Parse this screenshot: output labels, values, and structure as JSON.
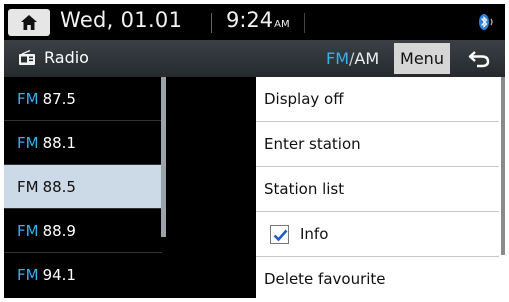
{
  "status_bar": {
    "date": "Wed, 01.01",
    "time": "9:24",
    "ampm": "AM"
  },
  "title_bar": {
    "title": "Radio",
    "band_fm": "FM",
    "band_sep": "/",
    "band_am": "AM",
    "menu_label": "Menu"
  },
  "stations": [
    {
      "band": "FM",
      "freq": "87.5"
    },
    {
      "band": "FM",
      "freq": "88.1"
    },
    {
      "band": "FM",
      "freq": "88.5"
    },
    {
      "band": "FM",
      "freq": "88.9"
    },
    {
      "band": "FM",
      "freq": "94.1"
    }
  ],
  "selected_station": 2,
  "menu": {
    "items": [
      {
        "label": "Display off"
      },
      {
        "label": "Enter station"
      },
      {
        "label": "Station list"
      },
      {
        "label": "Info",
        "checked": true
      },
      {
        "label": "Delete favourite"
      }
    ]
  },
  "colors": {
    "accent": "#3ab0ea",
    "selected_row": "#ccd9e6",
    "background": "#000000"
  }
}
